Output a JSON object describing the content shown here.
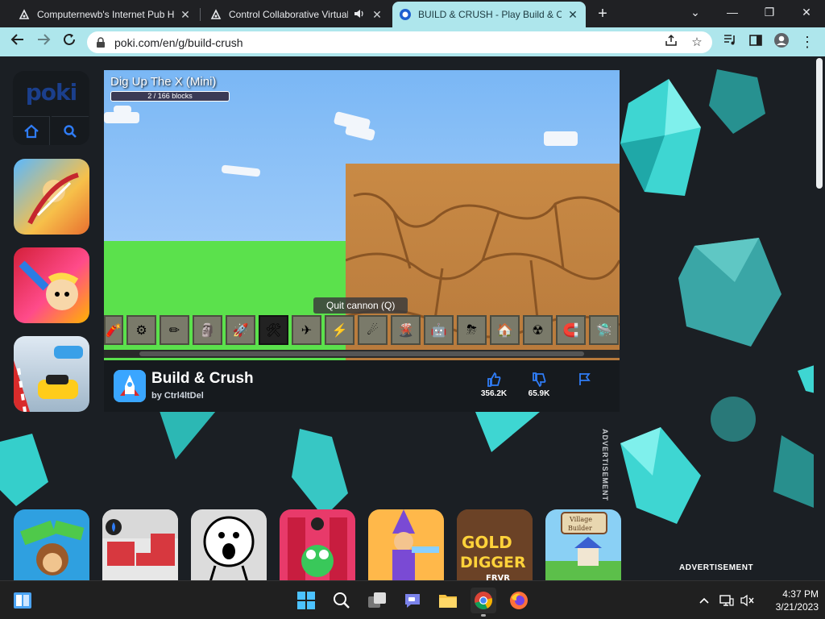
{
  "browser": {
    "tabs": [
      {
        "title": "Computernewb's Internet Pub Hc",
        "active": false
      },
      {
        "title": "Control Collaborative Virtual",
        "active": false
      },
      {
        "title": "BUILD & CRUSH - Play Build & C",
        "active": true
      }
    ],
    "url": "poki.com/en/g/build-crush",
    "accent": "#aee6ec"
  },
  "site": {
    "logo": "poki",
    "game": {
      "hud_title": "Dig Up The X (Mini)",
      "hud_progress_text": "2 / 166 blocks",
      "hud_progress_fraction": 0.012,
      "tooltip": "Quit cannon (Q)",
      "title": "Build & Crush",
      "author": "by Ctrl4ltDel",
      "likes": "356.2K",
      "dislikes": "65.9K"
    },
    "ad_vertical": "ADVERTISEMENT",
    "ad_horizontal": "ADVERTISEMENT"
  },
  "taskbar": {
    "time": "4:37 PM",
    "date": "3/21/2023"
  }
}
